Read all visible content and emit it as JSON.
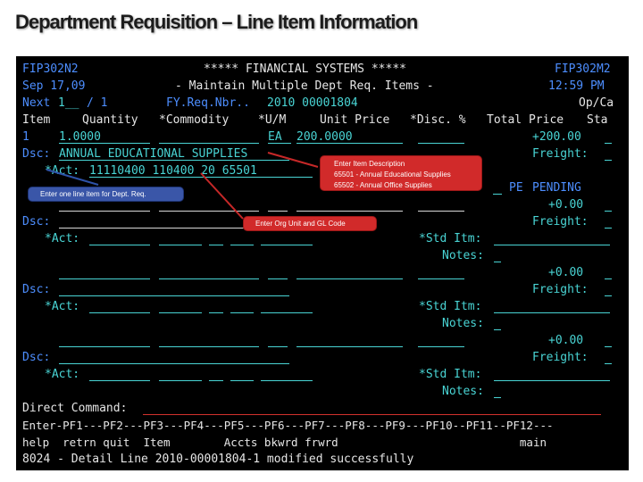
{
  "slide_title": "Department Requisition – Line Item Information",
  "screen": {
    "program_id": "FIP302N2",
    "header_title": "***** FINANCIAL SYSTEMS *****",
    "screen_code": "FIP302M2",
    "date": "Sep 17,09",
    "subtitle": "- Maintain Multiple Dept Req. Items -",
    "time": "12:59 PM",
    "next_label": "Next",
    "next_value": "1__",
    "next_of": "/ 1",
    "fy_label": "FY.Req.Nbr..",
    "fy_value": "2010 00001804",
    "opca_label": "Op/Ca",
    "col_item": "Item",
    "col_quantity": "Quantity",
    "col_commodity": "*Commodity",
    "col_um": "*U/M",
    "col_unit_price": "Unit Price",
    "col_disc": "*Disc. %",
    "col_total_price": "Total Price",
    "col_status": "Sta",
    "dsc_label": "Dsc:",
    "act_label": "*Act:",
    "std_itm_label": "*Std Itm:",
    "notes_label": "Notes:",
    "freight_label": "Freight:",
    "line1": {
      "item": "1",
      "quantity": "1.0000",
      "um": "EA",
      "unit_price": "200.0000",
      "total": "+200.00",
      "description": "ANNUAL EDUCATIONAL SUPPLIES",
      "account": "11110400 110400 20 65501",
      "status_code": "PE",
      "status_text": "PENDING"
    },
    "blank_total": "+0.00",
    "direct_command_label": "Direct Command:",
    "pf_keys": "Enter-PF1---PF2---PF3---PF4---PF5---PF6---PF7---PF8---PF9---PF10--PF11--PF12---",
    "pf_labels": "help  retrn quit  Item        Accts bkwrd frwrd                           main",
    "message": "8024 - Detail Line 2010-00001804-1 modified successfully"
  },
  "callouts": {
    "description": {
      "title": "Enter Item Description",
      "line1": "65501 - Annual Educational Supplies",
      "line2": "65502 - Annual Office Supplies"
    },
    "line_item": "Enter one line item for Dept. Req.",
    "org_unit": "Enter Org Unit and GL Code"
  }
}
